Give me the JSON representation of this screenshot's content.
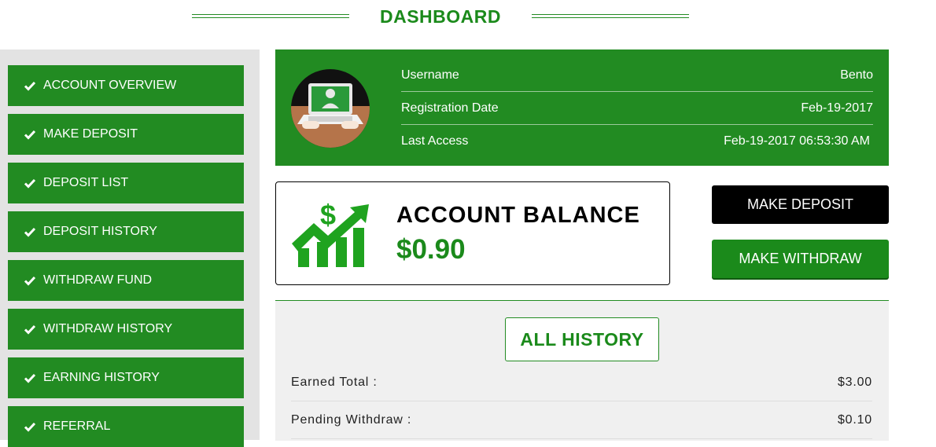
{
  "header": {
    "title": "DASHBOARD"
  },
  "sidebar": {
    "items": [
      {
        "label": "ACCOUNT OVERVIEW"
      },
      {
        "label": "MAKE DEPOSIT"
      },
      {
        "label": "DEPOSIT LIST"
      },
      {
        "label": "DEPOSIT HISTORY"
      },
      {
        "label": "WITHDRAW FUND"
      },
      {
        "label": "WITHDRAW HISTORY"
      },
      {
        "label": "EARNING HISTORY"
      },
      {
        "label": "REFERRAL"
      }
    ]
  },
  "profile": {
    "rows": [
      {
        "label": "Username",
        "value": "Bento"
      },
      {
        "label": "Registration Date",
        "value": "Feb-19-2017"
      },
      {
        "label": "Last Access",
        "value": "Feb-19-2017 06:53:30 AM"
      }
    ]
  },
  "balance": {
    "label": "ACCOUNT BALANCE",
    "amount": "$0.90"
  },
  "actions": {
    "deposit": "MAKE DEPOSIT",
    "withdraw": "MAKE WITHDRAW"
  },
  "history": {
    "title": "ALL HISTORY",
    "rows": [
      {
        "label": "Earned Total :",
        "value": "$3.00"
      },
      {
        "label": "Pending Withdraw :",
        "value": "$0.10"
      }
    ]
  },
  "colors": {
    "accent": "#228b22",
    "accent_text": "#1b8a1b",
    "sidebar_bg": "#e3e3e3",
    "history_bg": "#f0f0f0"
  },
  "icons": {
    "sidebar_item": "checkmark-icon",
    "avatar": "laptop-user-icon",
    "balance": "growth-chart-dollar-icon"
  }
}
